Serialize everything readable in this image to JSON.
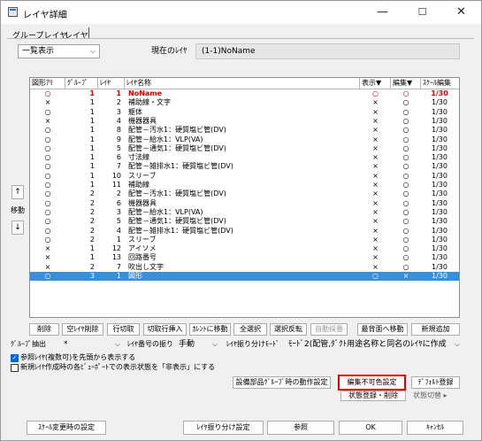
{
  "window": {
    "title": "レイヤ詳細",
    "min": "—",
    "max": "☐",
    "close": "✕"
  },
  "tabs": [
    "グループレイヤ",
    "レイヤ"
  ],
  "view_select": "一覧表示",
  "current_layer_label": "現在のﾚｲﾔ",
  "current_layer_value": "(1-1)NoName",
  "table": {
    "headers": [
      "図形ｱﾘ",
      "ｸﾞﾙｰﾌﾟ",
      "ﾚｲﾔ",
      "ﾚｲﾔ名称",
      "表示▼",
      "編集▼",
      "ｽｹｰﾙ編集"
    ],
    "rows": [
      {
        "has": "○",
        "grp": "1",
        "lay": "1",
        "name": "NoName",
        "vis": "○",
        "edit": "○",
        "scale": "1/30",
        "style": "red"
      },
      {
        "has": "×",
        "grp": "1",
        "lay": "2",
        "name": "補助線・文字",
        "vis": "×",
        "edit": "○",
        "scale": "1/30",
        "style": ""
      },
      {
        "has": "○",
        "grp": "1",
        "lay": "3",
        "name": "躯体",
        "vis": "×",
        "edit": "○",
        "scale": "1/30",
        "style": ""
      },
      {
        "has": "×",
        "grp": "1",
        "lay": "4",
        "name": "機器器具",
        "vis": "×",
        "edit": "○",
        "scale": "1/30",
        "style": ""
      },
      {
        "has": "○",
        "grp": "1",
        "lay": "8",
        "name": "配管－汚水1：硬質塩ビ管(DV)",
        "vis": "×",
        "edit": "○",
        "scale": "1/30",
        "style": ""
      },
      {
        "has": "○",
        "grp": "1",
        "lay": "9",
        "name": "配管－給水1：VLP(VA)",
        "vis": "×",
        "edit": "○",
        "scale": "1/30",
        "style": ""
      },
      {
        "has": "○",
        "grp": "1",
        "lay": "5",
        "name": "配管－通気1：硬質塩ビ管(DV)",
        "vis": "×",
        "edit": "○",
        "scale": "1/30",
        "style": ""
      },
      {
        "has": "○",
        "grp": "1",
        "lay": "6",
        "name": "寸法線",
        "vis": "×",
        "edit": "○",
        "scale": "1/30",
        "style": ""
      },
      {
        "has": "○",
        "grp": "1",
        "lay": "7",
        "name": "配管－雑排水1：硬質塩ビ管(DV)",
        "vis": "×",
        "edit": "○",
        "scale": "1/30",
        "style": ""
      },
      {
        "has": "○",
        "grp": "1",
        "lay": "10",
        "name": "スリーブ",
        "vis": "×",
        "edit": "○",
        "scale": "1/30",
        "style": ""
      },
      {
        "has": "○",
        "grp": "1",
        "lay": "11",
        "name": "補助線",
        "vis": "×",
        "edit": "○",
        "scale": "1/30",
        "style": ""
      },
      {
        "has": "○",
        "grp": "2",
        "lay": "2",
        "name": "配管－汚水1：硬質塩ビ管(DV)",
        "vis": "×",
        "edit": "○",
        "scale": "1/30",
        "style": ""
      },
      {
        "has": "○",
        "grp": "2",
        "lay": "6",
        "name": "機器器具",
        "vis": "×",
        "edit": "○",
        "scale": "1/30",
        "style": ""
      },
      {
        "has": "○",
        "grp": "2",
        "lay": "3",
        "name": "配管－給水1：VLP(VA)",
        "vis": "×",
        "edit": "○",
        "scale": "1/30",
        "style": ""
      },
      {
        "has": "○",
        "grp": "2",
        "lay": "5",
        "name": "配管－通気1：硬質塩ビ管(DV)",
        "vis": "×",
        "edit": "○",
        "scale": "1/30",
        "style": ""
      },
      {
        "has": "○",
        "grp": "2",
        "lay": "4",
        "name": "配管－雑排水1：硬質塩ビ管(DV)",
        "vis": "×",
        "edit": "○",
        "scale": "1/30",
        "style": ""
      },
      {
        "has": "○",
        "grp": "2",
        "lay": "1",
        "name": "スリーブ",
        "vis": "×",
        "edit": "○",
        "scale": "1/30",
        "style": ""
      },
      {
        "has": "×",
        "grp": "1",
        "lay": "12",
        "name": "アイソメ",
        "vis": "×",
        "edit": "○",
        "scale": "1/30",
        "style": ""
      },
      {
        "has": "×",
        "grp": "1",
        "lay": "13",
        "name": "回路番号",
        "vis": "×",
        "edit": "○",
        "scale": "1/30",
        "style": ""
      },
      {
        "has": "×",
        "grp": "2",
        "lay": "7",
        "name": "吹出し文字",
        "vis": "×",
        "edit": "○",
        "scale": "1/30",
        "style": ""
      },
      {
        "has": "○",
        "grp": "3",
        "lay": "1",
        "name": "図形",
        "vis": "○",
        "edit": "×",
        "scale": "1/30",
        "style": "sel"
      }
    ]
  },
  "move": {
    "up": "↑",
    "label": "移動",
    "down": "↓"
  },
  "buttons_row1": [
    "削除",
    "空ﾚｲﾔ削除",
    "行切取",
    "切取行挿入",
    "ｶﾚﾝﾄに移動",
    "全選択",
    "選択反転",
    "自動採番",
    "最背面へ移動",
    "新規追加"
  ],
  "group_extract_label": "ｸﾞﾙｰﾌﾟ抽出",
  "group_extract_value": "*",
  "layer_number_label": "ﾚｲﾔ番号の振り",
  "layer_number_value": "手動",
  "layer_assign_label": "ﾚｲﾔ振り分けﾓｰﾄﾞ",
  "layer_assign_value": "ﾓｰﾄﾞ2(配管,ﾀﾞｸﾄ用途名称と同名のﾚｲﾔに作成",
  "check1": "参照ﾚｲﾔ(複数可)を先頭から表示する",
  "check2": "新規ﾚｲﾔ作成時の各ﾋﾞｭｰﾎﾟｰﾄでの表示状態を「非表示」にする",
  "btn_equip_group": "設備部品ｸﾞﾙｰﾌﾟ時の動作設定",
  "btn_edit_disable_color": "編集不可色設定",
  "btn_default_register": "ﾃﾞﾌｫﾙﾄ登録",
  "btn_state_register": "状態登録・削除",
  "btn_state_switch": "状態切替 ▸",
  "bottom": [
    "ｽｹｰﾙ変更時の設定",
    "ﾚｲﾔ振り分け設定",
    "参照",
    "OK",
    "ｷｬﾝｾﾙ"
  ],
  "colors": {
    "selection": "#3b8fd9",
    "highlight_border": "#e10000",
    "current_text": "#e00000"
  }
}
